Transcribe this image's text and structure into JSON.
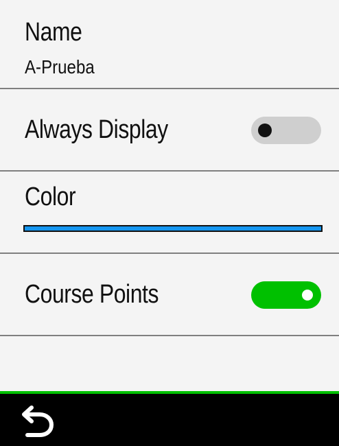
{
  "name_section": {
    "title": "Name",
    "value": "A-Prueba"
  },
  "always_display": {
    "label": "Always Display",
    "enabled": false
  },
  "color_section": {
    "label": "Color",
    "selected_color": "#1596f0"
  },
  "course_points": {
    "label": "Course Points",
    "enabled": true
  },
  "footer": {
    "back_icon": "back-arrow-icon"
  },
  "accent_colors": {
    "toggle_on": "#00c000",
    "toggle_off": "#cfcfcf",
    "footer": "#000000"
  }
}
